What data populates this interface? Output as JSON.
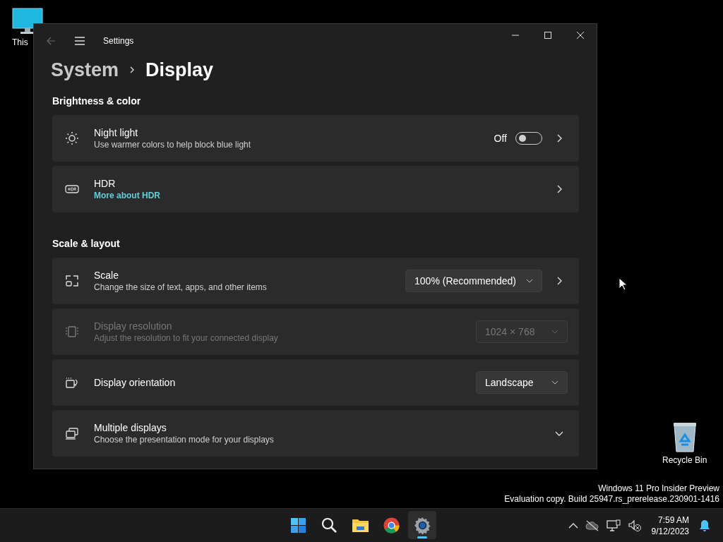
{
  "desktop_icons": [
    {
      "label": "This",
      "kind": "computer"
    },
    {
      "label": "Recycle Bin",
      "kind": "recycle"
    }
  ],
  "window": {
    "title": "Settings",
    "breadcrumb": [
      "System",
      "Display"
    ]
  },
  "sections": [
    {
      "heading": "Brightness & color",
      "items": [
        {
          "title": "Night light",
          "subtitle": "Use warmer colors to help block blue light",
          "toggle_label": "Off",
          "on": false,
          "opens_page": true
        },
        {
          "title": "HDR",
          "link": "More about HDR",
          "opens_page": true
        }
      ]
    },
    {
      "heading": "Scale & layout",
      "items": [
        {
          "title": "Scale",
          "subtitle": "Change the size of text, apps, and other items",
          "dropdown": "100% (Recommended)",
          "opens_page": true
        },
        {
          "title": "Display resolution",
          "subtitle": "Adjust the resolution to fit your connected display",
          "dropdown": "1024 × 768",
          "disabled": true
        },
        {
          "title": "Display orientation",
          "dropdown": "Landscape"
        },
        {
          "title": "Multiple displays",
          "subtitle": "Choose the presentation mode for your displays",
          "expanded": false
        }
      ]
    }
  ],
  "system_notice": [
    "Windows 11 Pro Insider Preview",
    "Evaluation copy. Build 25947.rs_prerelease.230901-1416"
  ],
  "taskbar": {
    "apps": [
      {
        "selected": false
      },
      {
        "selected": false
      },
      {
        "selected": false
      },
      {
        "selected": false
      },
      {
        "selected": true
      }
    ],
    "time": "7:59 AM",
    "date": "9/12/2023"
  }
}
